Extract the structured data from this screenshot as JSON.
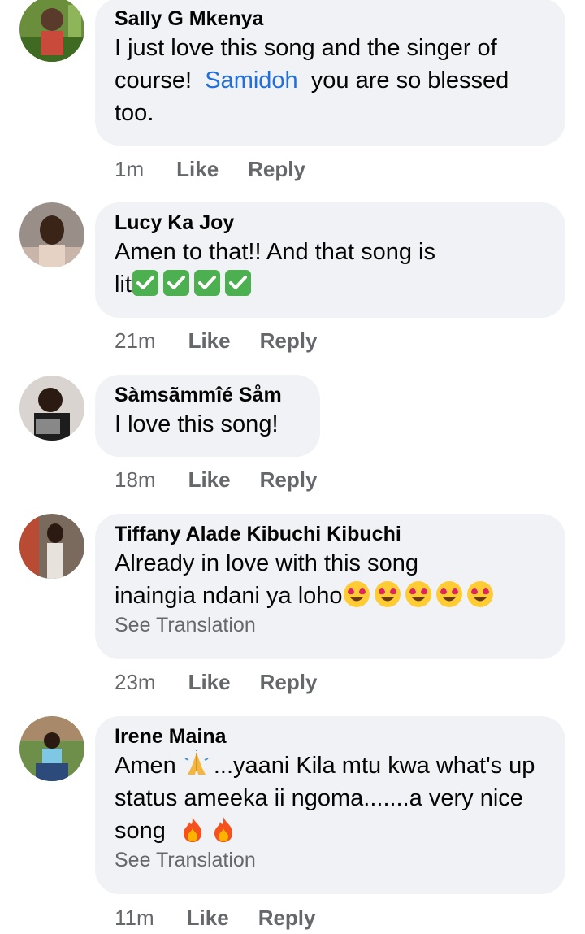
{
  "comments": [
    {
      "author": "Sally G Mkenya",
      "text_before": "I just love this song and the singer of course!  ",
      "mention": "Samidoh",
      "text_after": "  you are so blessed too.",
      "time": "1m",
      "like": "Like",
      "reply": "Reply"
    },
    {
      "author": "Lucy Ka Joy",
      "text_line1": "Amen to that!! And that song is",
      "text_line2": "lit",
      "emoji": "check-mark-emoji",
      "emoji_count": 4,
      "time": "21m",
      "like": "Like",
      "reply": "Reply"
    },
    {
      "author": "Sàmsãmmîé Såm",
      "text": "I love this song!",
      "time": "18m",
      "like": "Like",
      "reply": "Reply"
    },
    {
      "author": "Tiffany Alade Kibuchi Kibuchi",
      "text_line1": "Already in love with this song",
      "text_line2": "inaingia ndani ya loho",
      "emoji": "heart-eyes-emoji",
      "emoji_count": 5,
      "see_translation": "See Translation",
      "time": "23m",
      "like": "Like",
      "reply": "Reply"
    },
    {
      "author": "Irene Maina",
      "text_a": "Amen ",
      "text_b": "...yaani Kila mtu kwa what's up status ameeka ii ngoma.......a very nice song  ",
      "emoji_pray": "folded-hands-emoji",
      "emoji_fire": "fire-emoji",
      "see_translation": "See Translation",
      "time": "11m",
      "like": "Like",
      "reply": "Reply"
    }
  ],
  "colors": {
    "bubble": "#f0f2f5",
    "mention": "#216fdb",
    "meta": "#65676b",
    "text": "#050505"
  }
}
